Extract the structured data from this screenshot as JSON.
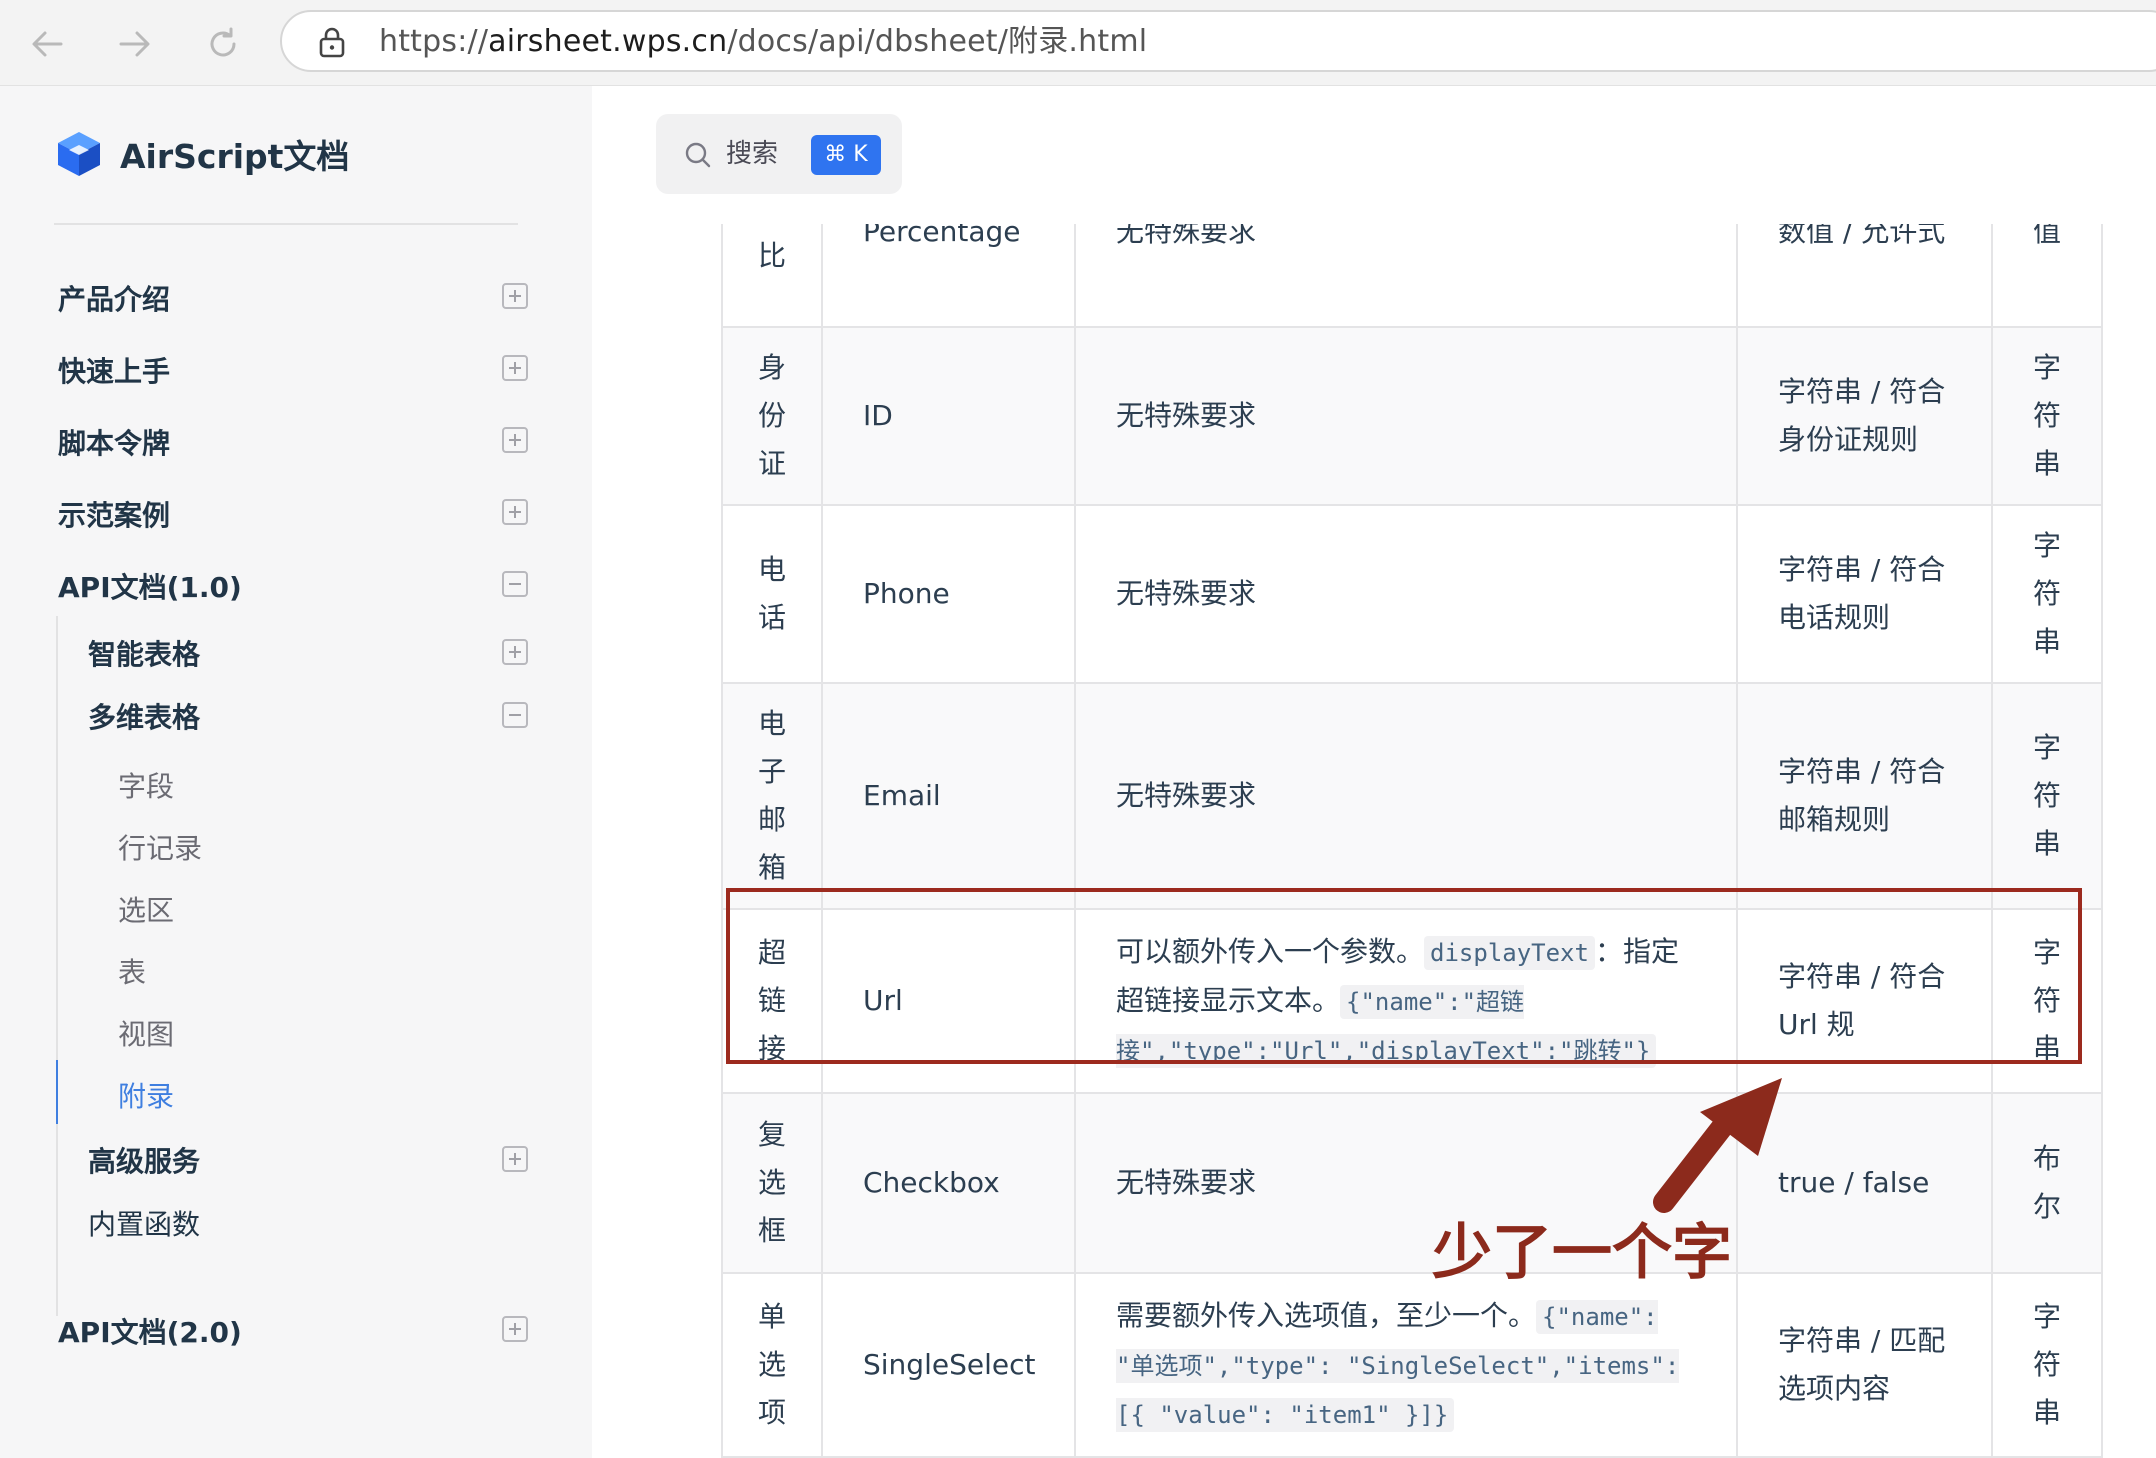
{
  "browser": {
    "url_prefix": "https://",
    "url_host": "airsheet.wps.cn",
    "url_path": "/docs/api/dbsheet/附录.html"
  },
  "sidebar": {
    "brand": "AirScript文档",
    "items": [
      {
        "label": "产品介绍",
        "toggle": "plus"
      },
      {
        "label": "快速上手",
        "toggle": "plus"
      },
      {
        "label": "脚本令牌",
        "toggle": "plus"
      },
      {
        "label": "示范案例",
        "toggle": "plus"
      },
      {
        "label": "API文档(1.0)",
        "toggle": "minus"
      },
      {
        "label": "智能表格",
        "toggle": "plus"
      },
      {
        "label": "多维表格",
        "toggle": "minus"
      },
      {
        "label": "字段"
      },
      {
        "label": "行记录"
      },
      {
        "label": "选区"
      },
      {
        "label": "表"
      },
      {
        "label": "视图"
      },
      {
        "label": "附录",
        "active": true
      },
      {
        "label": "高级服务",
        "toggle": "plus"
      },
      {
        "label": "内置函数"
      },
      {
        "label": "API文档(2.0)",
        "toggle": "plus"
      }
    ]
  },
  "search": {
    "label": "搜索",
    "shortcut": "⌘ K"
  },
  "table": {
    "rows": [
      {
        "name": "分比",
        "type": "Percentage",
        "desc": "无特殊要求",
        "input": "数值 / 允许式",
        "ret": "值"
      },
      {
        "name": "身份证",
        "type": "ID",
        "desc": "无特殊要求",
        "input": "字符串 / 符合身份证规则",
        "ret": "字符串"
      },
      {
        "name": "电话",
        "type": "Phone",
        "desc": "无特殊要求",
        "input": "字符串 / 符合电话规则",
        "ret": "字符串"
      },
      {
        "name": "电子邮箱",
        "type": "Email",
        "desc": "无特殊要求",
        "input": "字符串 / 符合邮箱规则",
        "ret": "字符串"
      },
      {
        "name": "超链接",
        "type": "Url",
        "desc_text": "可以额外传入一个参数。",
        "desc_code1": "displayText",
        "desc_text2": "：指定超链接显示文本。",
        "desc_code2": "{\"name\":\"超链接\",\"type\":\"Url\",\"displayText\":\"跳转\"}",
        "input": "字符串 / 符合Url 规",
        "ret": "字符串"
      },
      {
        "name": "复选框",
        "type": "Checkbox",
        "desc": "无特殊要求",
        "input": "true / false",
        "ret": "布尔"
      },
      {
        "name": "单选项",
        "type": "SingleSelect",
        "desc_text": "需要额外传入选项值，至少一个。",
        "desc_code1": "{\"name\": \"单选项\",\"type\": \"SingleSelect\",\"items\": [{ \"value\": \"item1\" }]}",
        "input": "字符串 / 匹配选项内容",
        "ret": "字符串"
      }
    ]
  },
  "annotation": {
    "text": "少了一个字"
  },
  "colors": {
    "accent": "#3f7fe0",
    "highlight": "#9c2a1e",
    "annotation": "#8c2a1c",
    "kbd_bg": "#2f74f0"
  }
}
